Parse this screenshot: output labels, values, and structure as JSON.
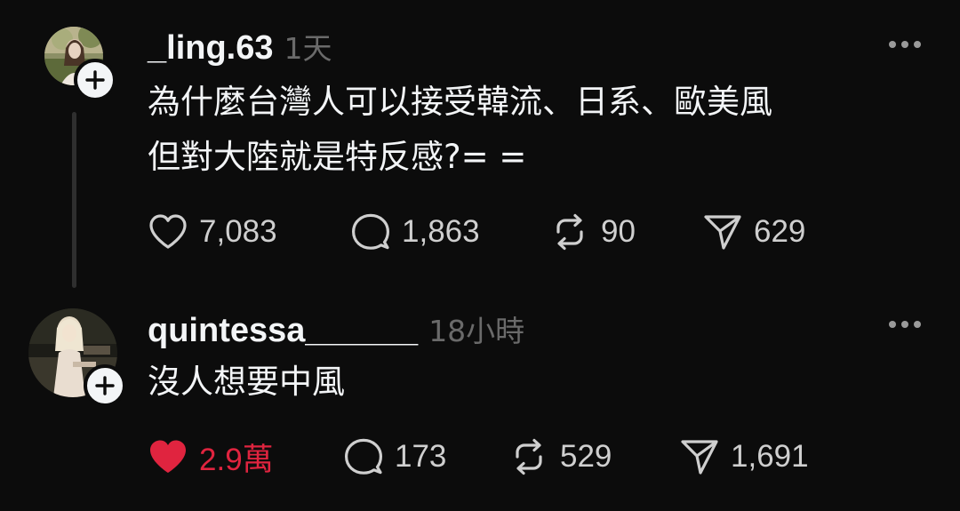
{
  "posts": [
    {
      "username": "_ling.63",
      "timestamp": "1天",
      "text_lines": [
        "為什麼台灣人可以接受韓流、日系、歐美風",
        "但對大陸就是特反感?= ="
      ],
      "likes": "7,083",
      "comments": "1,863",
      "reposts": "90",
      "shares": "629",
      "liked": false
    },
    {
      "username": "quintessa______",
      "timestamp": "18小時",
      "text_lines": [
        "沒人想要中風"
      ],
      "likes": "2.9萬",
      "comments": "173",
      "reposts": "529",
      "shares": "1,691",
      "liked": true
    }
  ],
  "colors": {
    "background": "#0c0c0c",
    "text_primary": "#f3f5f7",
    "text_secondary": "#6a6a6a",
    "icon": "#cfcfcf",
    "like_active": "#e0243f",
    "thread_line": "#2f2f2f"
  },
  "icons": {
    "like": "heart-icon",
    "comment": "speech-bubble-icon",
    "repost": "repost-arrows-icon",
    "share": "paper-plane-icon",
    "more": "more-horizontal-icon",
    "follow": "plus-icon"
  }
}
